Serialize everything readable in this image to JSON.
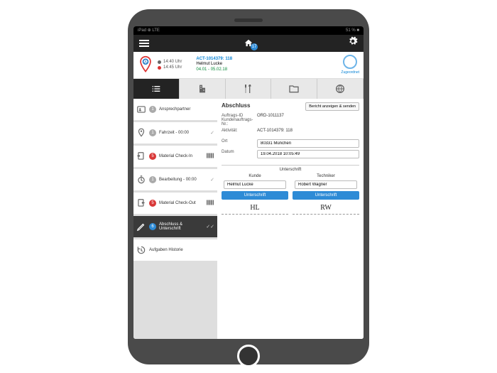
{
  "statusbar": {
    "left": "iPad ⊕ LTE",
    "right": "51 % ■"
  },
  "topbar": {
    "badge": "17"
  },
  "header": {
    "time1": "14:40 Uhr",
    "time2": "14:45 Uhr",
    "activity": "ACT-1014379: 118",
    "customer": "Helmut Lucke",
    "date": "04.01 - 05.02.18",
    "avatar_label": "Zugeordnet"
  },
  "sidebar": {
    "items": [
      {
        "label": "Ansprechpartner",
        "badge": "1",
        "badgeCls": "gray"
      },
      {
        "label": "Fahrzeit - 00:00",
        "badge": "1",
        "badgeCls": "gray",
        "chk": "✓"
      },
      {
        "label": "Material Check-In",
        "badge": "5",
        "badgeCls": "red",
        "barcode": true
      },
      {
        "label": "Bearbeitung - 00:00",
        "badge": "1",
        "badgeCls": "gray",
        "chk": "✓"
      },
      {
        "label": "Material Check-Out",
        "badge": "5",
        "badgeCls": "red",
        "barcode": true
      },
      {
        "label": "Abschluss & Unterschrift",
        "badge": "6",
        "badgeCls": "blue",
        "chk": "✓✓",
        "dark": true
      },
      {
        "label": "Aufgaben Historie"
      }
    ]
  },
  "main": {
    "title": "Abschluss",
    "report_btn": "Bericht anzeigen & senden",
    "order_lbl": "Auftrags-ID Kundenauftrags-Nr.:",
    "order_val": "ORD-1011137",
    "act_lbl": "Aktivität:",
    "act_val": "ACT-1014379: 118",
    "ort_lbl": "Ort",
    "ort_val": "80331 München",
    "datum_lbl": "Datum",
    "datum_val": "19.04.2018 10:05:49",
    "sig_title": "Unterschrift",
    "kunde_lbl": "Kunde",
    "kunde_name": "Helmut Lucke",
    "tech_lbl": "Techniker",
    "tech_name": "Robert Wagner",
    "sig_btn": "Unterschrift",
    "sig1": "HL",
    "sig2": "RW"
  }
}
